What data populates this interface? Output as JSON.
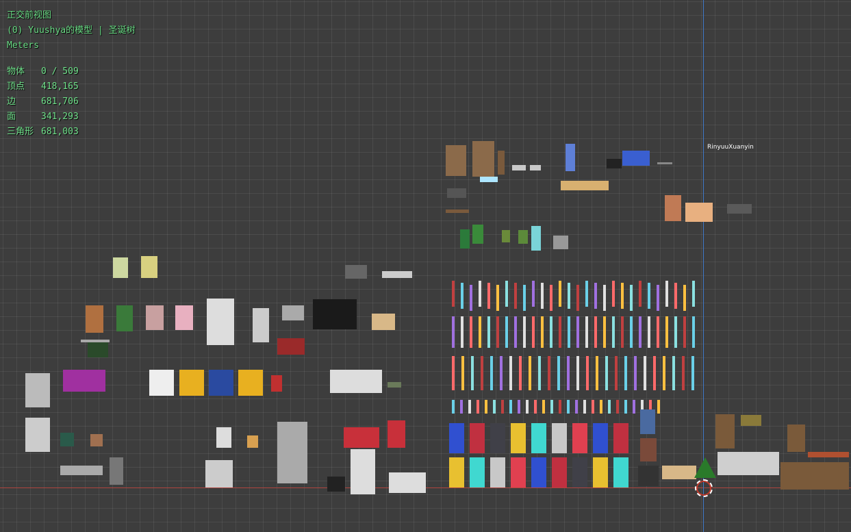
{
  "view": {
    "title": "正交前视图",
    "collection": "(0) Yuushya的模型 | 圣诞树",
    "units": "Meters"
  },
  "stats": [
    {
      "label": "物体",
      "value": "0 / 509"
    },
    {
      "label": "顶点",
      "value": "418,165"
    },
    {
      "label": "边",
      "value": "681,706"
    },
    {
      "label": "面",
      "value": "341,293"
    },
    {
      "label": "三角形",
      "value": "681,003"
    }
  ],
  "object_label": "RinyuuXuanyin",
  "colors": {
    "overlay_text": "#6fe08a",
    "grid_bg": "#3d3d3d",
    "x_axis": "#b0453f",
    "z_axis": "#3f78c8"
  }
}
